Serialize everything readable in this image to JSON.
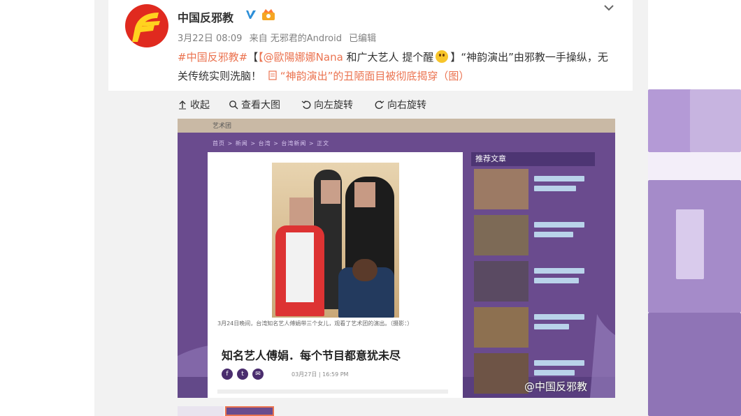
{
  "post": {
    "nickname": "中国反邪教",
    "meta": {
      "date": "3月22日 08:09",
      "source": "来自 无邪君的Android",
      "edited": "已编辑"
    },
    "text": {
      "hashtag": "#中国反邪教#",
      "mention": "【@歐陽娜娜Nana",
      "body1": " 和广大艺人 提个醒",
      "body2": "】“神韵演出”由邪教一手操纵，无关传统实则洗脑！",
      "link": "“神韵演出”的丑陋面目被彻底揭穿（图）"
    }
  },
  "toolbar": {
    "collapse": "收起",
    "view_large": "查看大图",
    "rotate_left": "向左旋转",
    "rotate_right": "向右旋转"
  },
  "embedded": {
    "site_label": "艺术团",
    "breadcrumb": "首页  >  新闻  >  台湾  >  台湾新闻  >  正文",
    "caption": "3月24日晚间，台湾知名艺人傅娟带三个女儿，观看了艺术团的演出。（摄影：）",
    "headline": "知名艺人傅娟．每个节目都意犹未尽",
    "pubtime": "03月27日 | 16:59 PM",
    "sidebar_title": "推荐文章"
  },
  "watermark": "@中国反邪教",
  "colors": {
    "accent_orange": "#eb7350",
    "brand_red": "#e02a1f",
    "purple": "#6a4b8e",
    "verified_blue": "#2d8fd8"
  }
}
